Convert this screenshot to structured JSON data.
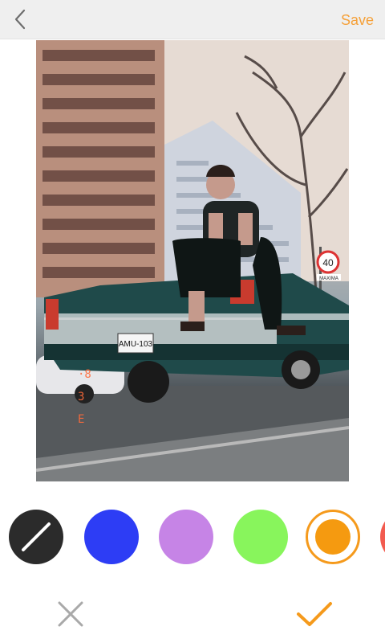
{
  "header": {
    "back_icon": "chevron-left-icon",
    "save_label": "Save",
    "save_color": "#f5a13a"
  },
  "photo": {
    "description_icon": "photo-preview",
    "plate_text": "AMU-103",
    "sign_text": "40",
    "sign_subtext": "MAXIMA"
  },
  "palette": {
    "colors": [
      {
        "name": "eraser",
        "hex": "#2b2b2b",
        "icon": "slash-icon"
      },
      {
        "name": "blue",
        "hex": "#2d3df5"
      },
      {
        "name": "purple",
        "hex": "#c684e6"
      },
      {
        "name": "green",
        "hex": "#88f55c"
      },
      {
        "name": "orange",
        "hex": "#f59a10",
        "selected": true
      },
      {
        "name": "red",
        "hex": "#f25b4f"
      }
    ]
  },
  "footer": {
    "cancel_icon": "close-icon",
    "confirm_icon": "check-icon",
    "cancel_color": "#a9a9a9",
    "confirm_color": "#f59a1c"
  }
}
